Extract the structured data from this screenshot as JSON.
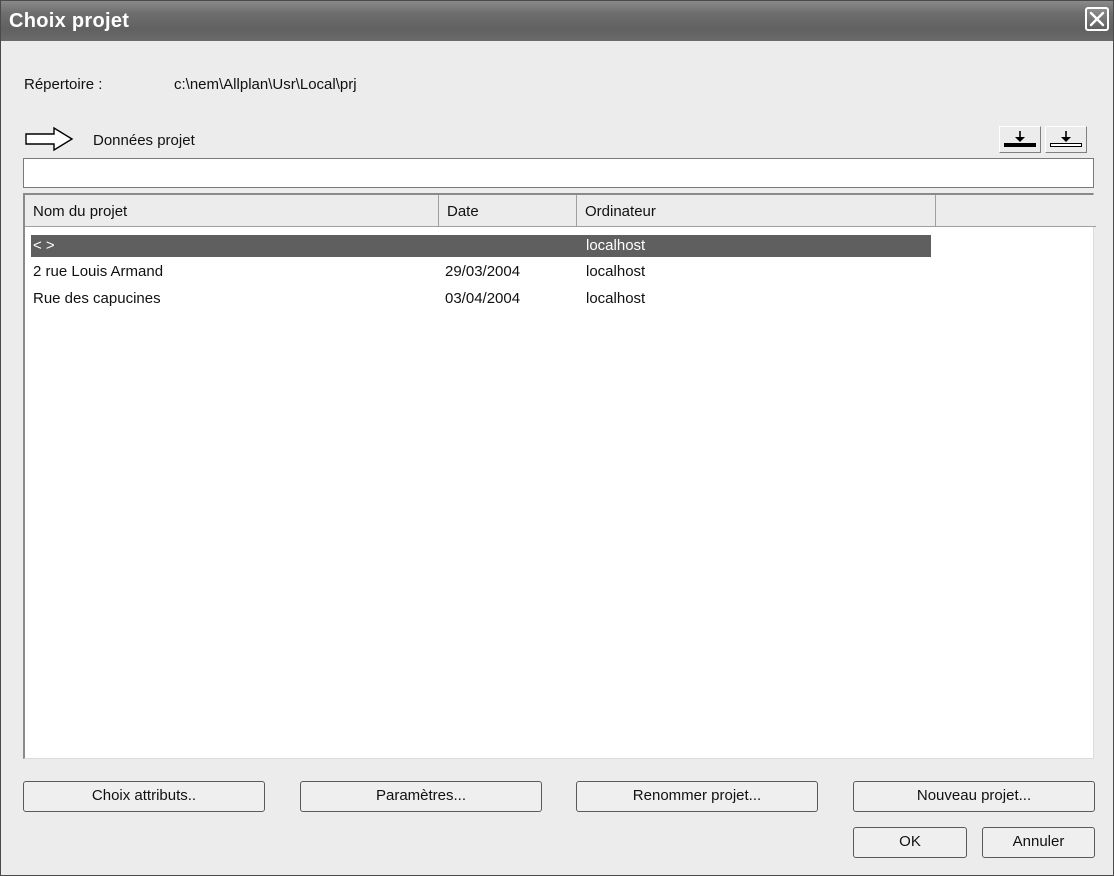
{
  "window": {
    "title": "Choix projet"
  },
  "directory": {
    "label": "Répertoire :",
    "value": "c:\\nem\\Allplan\\Usr\\Local\\prj"
  },
  "section": {
    "label": "Données projet"
  },
  "filter": {
    "value": ""
  },
  "table": {
    "columns": [
      "Nom du projet",
      "Date",
      "Ordinateur"
    ],
    "rows": [
      {
        "name": "<    >",
        "date": "",
        "computer": "localhost",
        "selected": true
      },
      {
        "name": "2 rue Louis Armand",
        "date": "29/03/2004",
        "computer": "localhost",
        "selected": false
      },
      {
        "name": "Rue des capucines",
        "date": "03/04/2004",
        "computer": "localhost",
        "selected": false
      }
    ]
  },
  "buttons": {
    "choose_attributes": "Choix attributs..",
    "parameters": "Paramètres...",
    "rename_project": "Renommer projet...",
    "new_project": "Nouveau projet...",
    "ok": "OK",
    "cancel": "Annuler"
  },
  "colors": {
    "titlebar": "#6e6e6e",
    "selection": "#5f5f5f"
  }
}
